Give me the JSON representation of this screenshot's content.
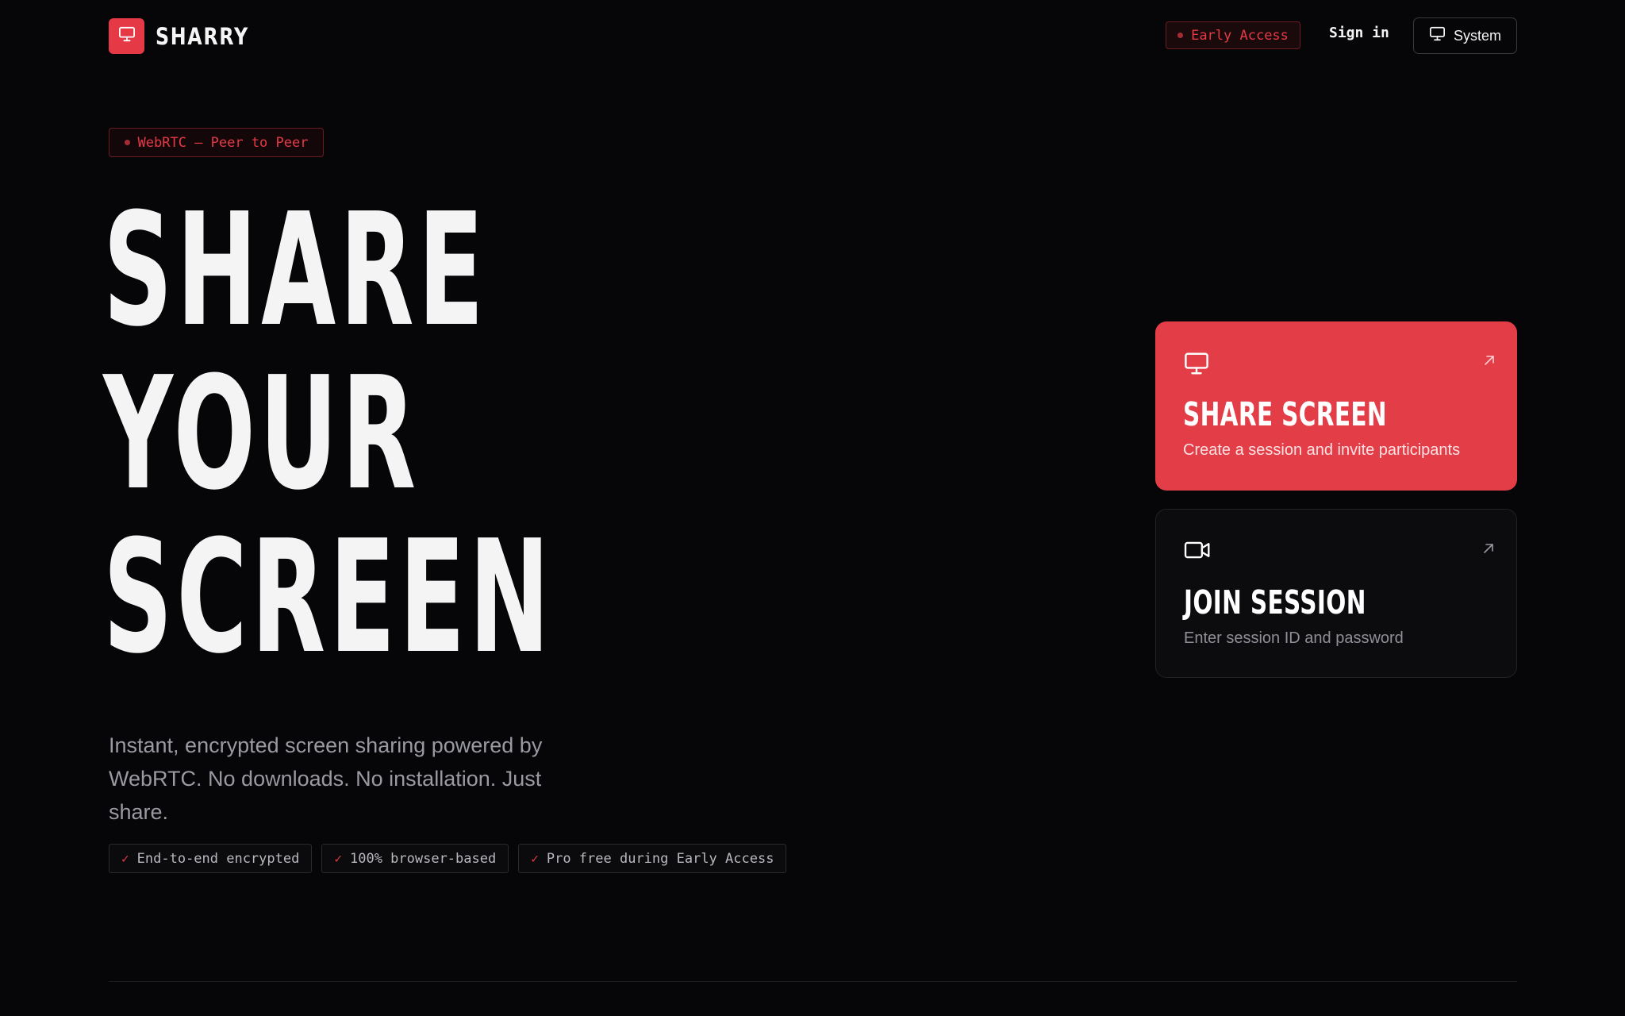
{
  "brand": {
    "name": "SHARRY",
    "icon": "monitor-icon",
    "accent": "#e63946"
  },
  "nav": {
    "early_access": "Early Access",
    "sign_in": "Sign in",
    "theme_button": "System",
    "theme_icon": "monitor-icon"
  },
  "tag": {
    "label": "WebRTC — Peer to Peer"
  },
  "hero": {
    "line1": "SHARE",
    "line2": "YOUR",
    "line3": "SCREEN",
    "description": "Instant, encrypted screen sharing powered by WebRTC. No downloads. No installation. Just share."
  },
  "features": [
    {
      "label": "End-to-end encrypted",
      "icon": "check-icon"
    },
    {
      "label": "100% browser-based",
      "icon": "check-icon"
    },
    {
      "label": "Pro free during Early Access",
      "icon": "check-icon"
    }
  ],
  "cards": {
    "share": {
      "title": "SHARE SCREEN",
      "subtitle": "Create a session and invite participants",
      "icon": "monitor-icon",
      "arrow_icon": "arrow-up-right-icon",
      "color": "#e33d47"
    },
    "join": {
      "title": "JOIN SESSION",
      "subtitle": "Enter session ID and password",
      "icon": "video-camera-icon",
      "arrow_icon": "arrow-up-right-icon",
      "color": "#0c0c0f"
    }
  }
}
